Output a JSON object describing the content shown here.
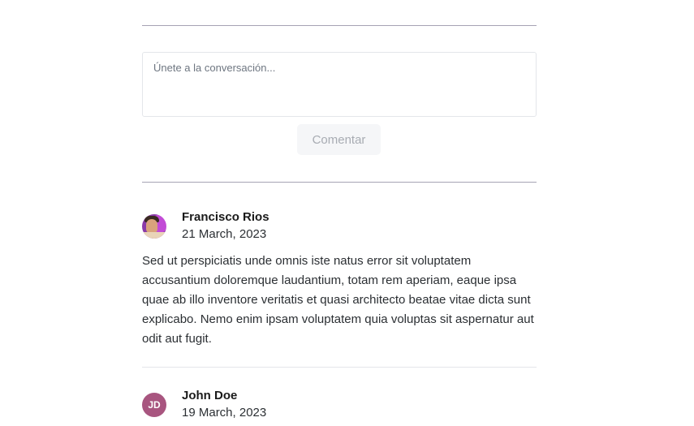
{
  "comment_form": {
    "placeholder": "Únete a la conversación...",
    "submit_label": "Comentar"
  },
  "comments": [
    {
      "author": "Francisco Rios",
      "date": "21 March, 2023",
      "avatar": "photo",
      "text": "Sed ut perspiciatis unde omnis iste natus error sit voluptatem accusantium doloremque laudantium, totam rem aperiam, eaque ipsa quae ab illo inventore veritatis et quasi architecto beatae vitae dicta sunt explicabo. Nemo enim ipsam voluptatem quia voluptas sit aspernatur aut odit aut fugit."
    },
    {
      "author": "John Doe",
      "date": "19 March, 2023",
      "avatar": "initials",
      "initials": "JD"
    }
  ],
  "colors": {
    "avatar_jd": "#a8557f",
    "divider": "#a6a3b4"
  }
}
